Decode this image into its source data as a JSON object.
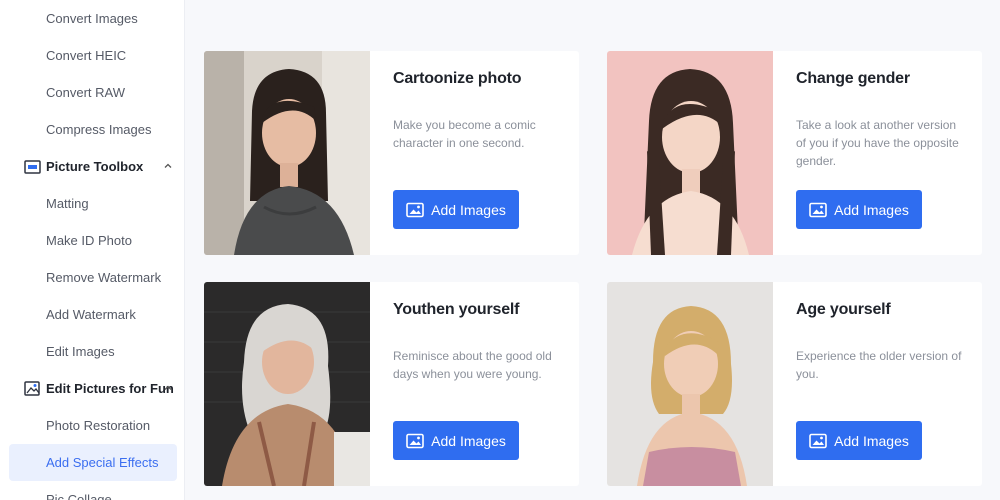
{
  "sidebar": {
    "items_top": [
      "Convert Images",
      "Convert HEIC",
      "Convert RAW",
      "Compress Images"
    ],
    "section_toolbox": "Picture Toolbox",
    "items_toolbox": [
      "Matting",
      "Make ID Photo",
      "Remove Watermark",
      "Add Watermark",
      "Edit Images"
    ],
    "section_fun": "Edit Pictures for Fun",
    "items_fun": [
      "Photo Restoration",
      "Add Special Effects",
      "Pic Collage"
    ],
    "active_item": "Add Special Effects"
  },
  "cards": [
    {
      "title": "Cartoonize photo",
      "description": "Make you become a comic character in one second.",
      "button": "Add Images",
      "photo_icon": "young-woman-portrait"
    },
    {
      "title": "Change gender",
      "description": "Take a look at another version of you if you have the opposite gender.",
      "button": "Add Images",
      "photo_icon": "young-woman-pink-background-portrait"
    },
    {
      "title": "Youthen yourself",
      "description": "Reminisce about the good old days when you were young.",
      "button": "Add Images",
      "photo_icon": "older-woman-gray-hair-portrait"
    },
    {
      "title": "Age yourself",
      "description": "Experience the older version of you.",
      "button": "Add Images",
      "photo_icon": "blonde-woman-portrait"
    }
  ],
  "colors": {
    "accent": "#2f6df0",
    "active_bg": "#eaf0fe",
    "page_bg": "#f7f8fb"
  }
}
